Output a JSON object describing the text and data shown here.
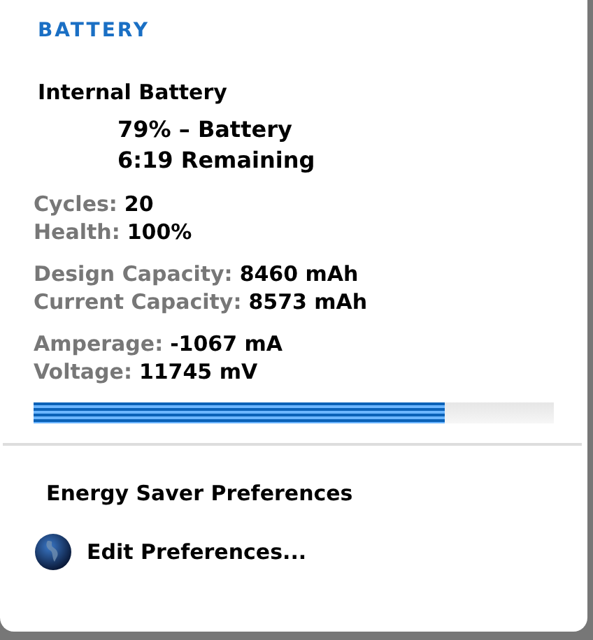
{
  "section_title": "BATTERY",
  "battery": {
    "name": "Internal Battery",
    "status": [
      "79% – Battery",
      "6:19 Remaining"
    ],
    "groups": [
      [
        {
          "label": "Cycles:",
          "value": "20"
        },
        {
          "label": "Health:",
          "value": "100%"
        }
      ],
      [
        {
          "label": "Design Capacity:",
          "value": "8460 mAh"
        },
        {
          "label": "Current Capacity:",
          "value": "8573 mAh"
        }
      ],
      [
        {
          "label": "Amperage:",
          "value": "-1067 mA"
        },
        {
          "label": "Voltage:",
          "value": "11745 mV"
        }
      ]
    ],
    "level": 0.79
  },
  "menu": {
    "heading": "Energy Saver Preferences",
    "items": [
      {
        "label": "Edit Preferences..."
      }
    ]
  }
}
